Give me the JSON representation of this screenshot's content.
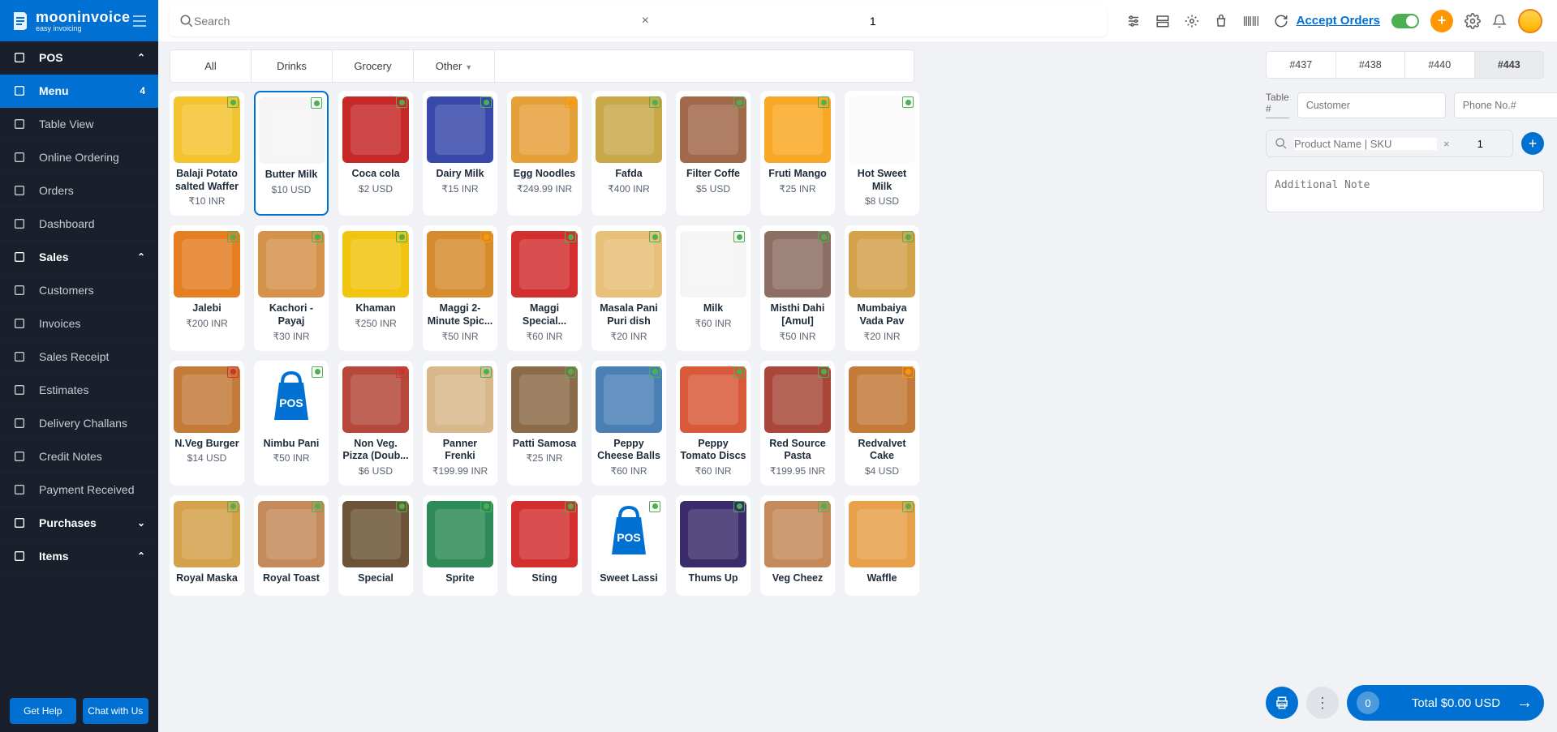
{
  "brand": {
    "name": "mooninvoice",
    "tag": "easy invoicing"
  },
  "header": {
    "search_ph": "Search",
    "search_num": "1",
    "accept": "Accept Orders"
  },
  "sidebar": {
    "items": [
      {
        "id": "pos",
        "label": "POS",
        "bold": true,
        "chev": "up"
      },
      {
        "id": "menu",
        "label": "Menu",
        "active": true,
        "badge": "4"
      },
      {
        "id": "table",
        "label": "Table View"
      },
      {
        "id": "online",
        "label": "Online Ordering"
      },
      {
        "id": "orders",
        "label": "Orders"
      },
      {
        "id": "dashboard",
        "label": "Dashboard"
      },
      {
        "id": "sales",
        "label": "Sales",
        "bold": true,
        "chev": "up"
      },
      {
        "id": "customers",
        "label": "Customers"
      },
      {
        "id": "invoices",
        "label": "Invoices"
      },
      {
        "id": "receipt",
        "label": "Sales Receipt"
      },
      {
        "id": "estimates",
        "label": "Estimates"
      },
      {
        "id": "delivery",
        "label": "Delivery Challans"
      },
      {
        "id": "credit",
        "label": "Credit Notes"
      },
      {
        "id": "payment",
        "label": "Payment Received"
      },
      {
        "id": "purchases",
        "label": "Purchases",
        "bold": true,
        "chev": "down"
      },
      {
        "id": "items",
        "label": "Items",
        "bold": true,
        "chev": "up"
      }
    ],
    "help": "Get Help",
    "chat": "Chat with Us"
  },
  "categories": [
    "All",
    "Drinks",
    "Grocery",
    "Other"
  ],
  "products": [
    {
      "name": "Balaji Potato salted Waffer",
      "price": "₹10 INR",
      "diet": "v",
      "color": "#f4c430"
    },
    {
      "name": "Butter Milk",
      "price": "$10 USD",
      "diet": "v",
      "sel": true,
      "color": "#f5f5f5"
    },
    {
      "name": "Coca cola",
      "price": "$2 USD",
      "diet": "v",
      "color": "#c62828"
    },
    {
      "name": "Dairy Milk",
      "price": "₹15 INR",
      "diet": "v",
      "color": "#3949ab"
    },
    {
      "name": "Egg Noodles",
      "price": "₹249.99 INR",
      "diet": "o",
      "color": "#e6a03a"
    },
    {
      "name": "Fafda",
      "price": "₹400 INR",
      "diet": "v",
      "color": "#c9a84a"
    },
    {
      "name": "Filter Coffe",
      "price": "$5 USD",
      "diet": "v",
      "color": "#a1684a"
    },
    {
      "name": "Fruti Mango",
      "price": "₹25 INR",
      "diet": "v",
      "color": "#f9a825"
    },
    {
      "name": "Hot Sweet Milk",
      "price": "$8 USD",
      "diet": "v",
      "color": "#fafafa"
    },
    {
      "name": "Jalebi",
      "price": "₹200 INR",
      "diet": "v",
      "color": "#e67e22"
    },
    {
      "name": "Kachori - Payaj",
      "price": "₹30 INR",
      "diet": "v",
      "color": "#d4924a"
    },
    {
      "name": "Khaman",
      "price": "₹250 INR",
      "diet": "v",
      "color": "#f1c40f"
    },
    {
      "name": "Maggi 2-Minute Spic...",
      "price": "₹50 INR",
      "diet": "o",
      "color": "#d68b2e"
    },
    {
      "name": "Maggi Special...",
      "price": "₹60 INR",
      "diet": "v",
      "color": "#d32f2f"
    },
    {
      "name": "Masala Pani Puri dish",
      "price": "₹20 INR",
      "diet": "v",
      "color": "#e8c07a"
    },
    {
      "name": "Milk",
      "price": "₹60 INR",
      "diet": "v",
      "color": "#f5f5f5"
    },
    {
      "name": "Misthi Dahi [Amul]",
      "price": "₹50 INR",
      "diet": "v",
      "color": "#8d6e63"
    },
    {
      "name": "Mumbaiya Vada Pav",
      "price": "₹20 INR",
      "diet": "v",
      "color": "#d4a24a"
    },
    {
      "name": "N.Veg Burger",
      "price": "$14 USD",
      "diet": "n",
      "color": "#c47b3a"
    },
    {
      "name": "Nimbu Pani",
      "price": "₹50 INR",
      "diet": "v",
      "color": "#0070d2",
      "pos": true
    },
    {
      "name": "Non Veg. Pizza (Doub...",
      "price": "$6 USD",
      "diet": "n",
      "color": "#b5483a"
    },
    {
      "name": "Panner Frenki",
      "price": "₹199.99 INR",
      "diet": "v",
      "color": "#d8b88a"
    },
    {
      "name": "Patti Samosa",
      "price": "₹25 INR",
      "diet": "v",
      "color": "#8c6b4a"
    },
    {
      "name": "Peppy Cheese Balls",
      "price": "₹60 INR",
      "diet": "v",
      "color": "#4a7fb5"
    },
    {
      "name": "Peppy Tomato Discs",
      "price": "₹60 INR",
      "diet": "v",
      "color": "#d85a3a"
    },
    {
      "name": "Red Source Pasta",
      "price": "₹199.95 INR",
      "diet": "v",
      "color": "#a8473a"
    },
    {
      "name": "Redvalvet Cake",
      "price": "$4 USD",
      "diet": "o",
      "color": "#c47b3a"
    },
    {
      "name": "Royal Maska",
      "price": "",
      "diet": "v",
      "color": "#d4a24a"
    },
    {
      "name": "Royal Toast",
      "price": "",
      "diet": "v",
      "color": "#c48a5a"
    },
    {
      "name": "Special",
      "price": "",
      "diet": "v",
      "color": "#6d5438"
    },
    {
      "name": "Sprite",
      "price": "",
      "diet": "v",
      "color": "#2e8b57"
    },
    {
      "name": "Sting",
      "price": "",
      "diet": "v",
      "color": "#d32f2f"
    },
    {
      "name": "Sweet Lassi",
      "price": "",
      "diet": "v",
      "color": "#0070d2",
      "pos": true
    },
    {
      "name": "Thums Up",
      "price": "",
      "diet": "v",
      "color": "#3a2c6b"
    },
    {
      "name": "Veg Cheez",
      "price": "",
      "diet": "v",
      "color": "#c48a5a"
    },
    {
      "name": "Waffle",
      "price": "",
      "diet": "v",
      "color": "#e8a04a"
    }
  ],
  "order": {
    "tabs": [
      "#437",
      "#438",
      "#440",
      "#443"
    ],
    "active_tab": 3,
    "table_label": "Table #",
    "customer_ph": "Customer",
    "phone_ph": "Phone No.#",
    "product_ph": "Product Name | SKU",
    "product_num": "1",
    "note_ph": "Additional Note",
    "count": "0",
    "total": "Total $0.00 USD"
  }
}
